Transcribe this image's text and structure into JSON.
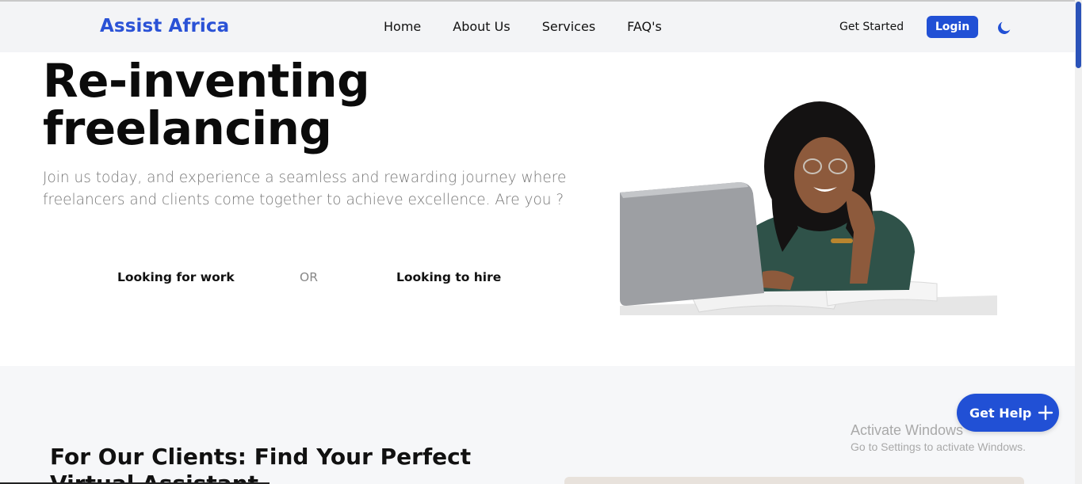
{
  "nav": {
    "brand": "Assist Africa",
    "links": [
      "Home",
      "About Us",
      "Services",
      "FAQ's"
    ],
    "get_started": "Get Started",
    "login": "Login",
    "theme_icon": "moon-icon"
  },
  "hero": {
    "title_line1": "Re-inventing",
    "title_line2": "freelancing",
    "subtitle": "Join us today, and experience a seamless and rewarding journey where freelancers and clients come together to achieve excellence. Are you ?",
    "option_work": "Looking for work",
    "option_or": "OR",
    "option_hire": "Looking to hire"
  },
  "section2": {
    "title": "For Our Clients: Find Your Perfect Virtual Assistant"
  },
  "help": {
    "label": "Get Help",
    "icon": "plus-icon"
  },
  "watermark": {
    "line1": "Activate Windows",
    "line2": "Go to Settings to activate Windows."
  },
  "colors": {
    "brand": "#2a52d6",
    "button": "#2150d5",
    "nav_bg": "#f3f4f6"
  }
}
